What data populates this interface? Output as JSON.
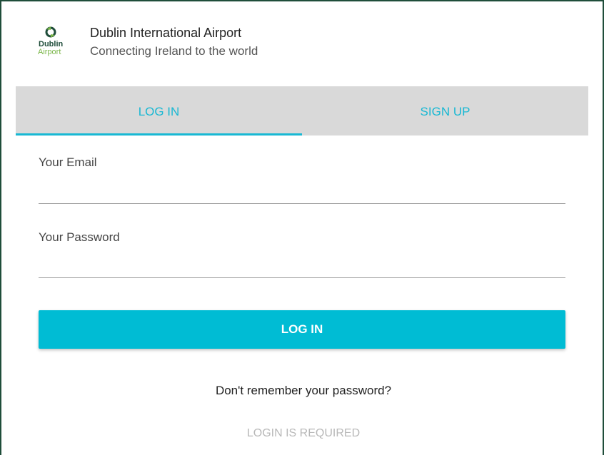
{
  "header": {
    "logo_line1": "Dublin",
    "logo_line2": "Airport",
    "logo_icon": "dublin-airport-logo-icon",
    "title": "Dublin International Airport",
    "subtitle": "Connecting Ireland to the world"
  },
  "tabs": [
    {
      "label": "LOG IN",
      "active": true
    },
    {
      "label": "SIGN UP",
      "active": false
    }
  ],
  "form": {
    "email_label": "Your Email",
    "email_value": "",
    "password_label": "Your Password",
    "password_value": "",
    "submit_label": "LOG IN"
  },
  "footer": {
    "forgot_password": "Don't remember your password?",
    "status": "LOGIN IS REQUIRED"
  },
  "colors": {
    "accent": "#00bcd4",
    "tab_text": "#18b8d3",
    "tab_bg": "#d9d9d9",
    "border": "#1f4d3a",
    "logo_green": "#7ab648"
  }
}
